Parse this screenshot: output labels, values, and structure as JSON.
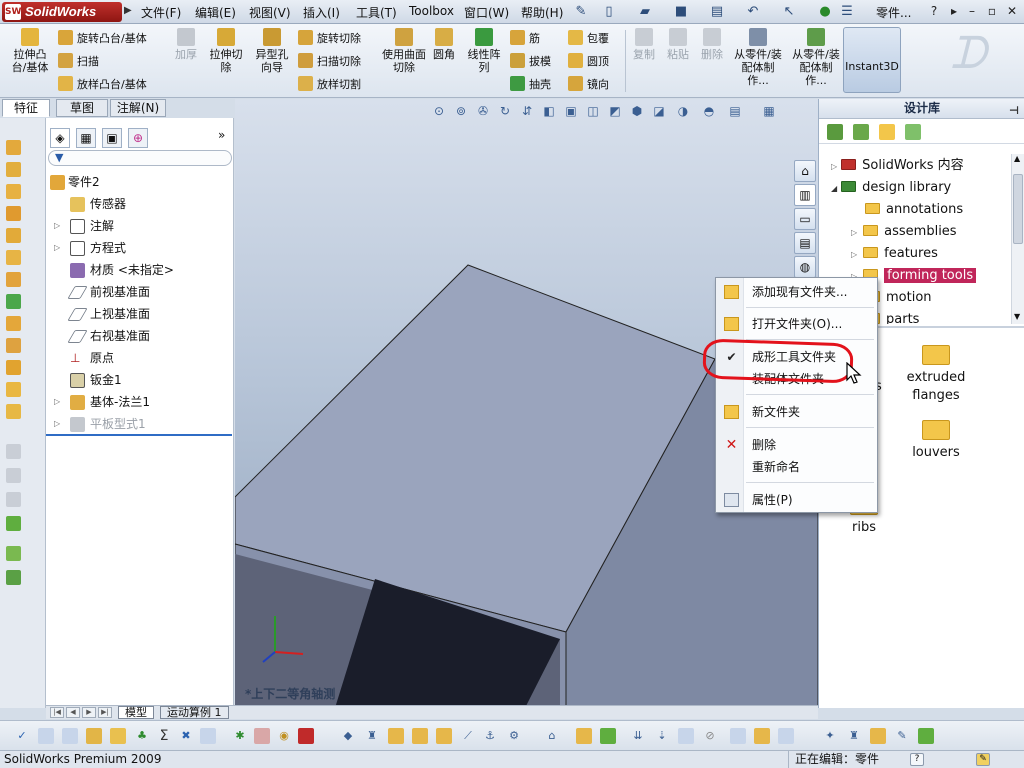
{
  "app": {
    "brand": "SolidWorks",
    "logo_glyph": "SW",
    "document_title": "零件...",
    "menu": [
      "文件(F)",
      "编辑(E)",
      "视图(V)",
      "插入(I)",
      "工具(T)",
      "Toolbox",
      "窗口(W)",
      "帮助(H)"
    ]
  },
  "ribbon": {
    "extrude_boss": "拉伸凸台/基体",
    "revolve_boss": "旋转凸台/基体",
    "sweep": "扫描",
    "loft": "放样凸台/基体",
    "thicken": "加厚",
    "extrude_cut": "拉伸切除",
    "hole_wizard": "异型孔向导",
    "revolve_cut": "旋转切除",
    "sweep_cut": "扫描切除",
    "loft_cut": "放样切割",
    "surface_cut": "使用曲面切除",
    "fillet": "圆角",
    "linear_pattern": "线性阵列",
    "rib": "筋",
    "draft": "拔模",
    "shell": "抽壳",
    "wrap": "包覆",
    "dome": "圆顶",
    "mirror": "镜向",
    "copy": "复制",
    "paste": "粘贴",
    "delete": "删除",
    "from_part_assembly": "从零件/装配体制作...",
    "from_part_assembly2": "从零件/装配体制作...",
    "instant3d": "Instant3D"
  },
  "command_tabs": [
    "特征",
    "草图",
    "注解(N)"
  ],
  "feature_tree": {
    "root": "零件2",
    "items": [
      {
        "label": "传感器",
        "expandable": false
      },
      {
        "label": "注解",
        "expandable": true
      },
      {
        "label": "方程式",
        "expandable": true
      },
      {
        "label": "材质 <未指定>",
        "expandable": false
      },
      {
        "label": "前视基准面",
        "expandable": false
      },
      {
        "label": "上视基准面",
        "expandable": false
      },
      {
        "label": "右视基准面",
        "expandable": false
      },
      {
        "label": "原点",
        "expandable": false
      },
      {
        "label": "钣金1",
        "expandable": false
      },
      {
        "label": "基体-法兰1",
        "expandable": true
      },
      {
        "label": "平板型式1",
        "expandable": true,
        "suppressed": true
      }
    ]
  },
  "graphics": {
    "view_orientation": "*上下二等角轴测"
  },
  "design_library": {
    "title": "设计库",
    "tree": [
      {
        "label": "SolidWorks 内容",
        "level": 0
      },
      {
        "label": "design library",
        "level": 0
      },
      {
        "label": "annotations",
        "level": 1
      },
      {
        "label": "assemblies",
        "level": 1
      },
      {
        "label": "features",
        "level": 1
      },
      {
        "label": "forming tools",
        "level": 1,
        "selected": true
      },
      {
        "label": "motion",
        "level": 1
      },
      {
        "label": "parts",
        "level": 1
      }
    ],
    "tiles": {
      "partial": "es",
      "extruded_flanges": "extruded flanges",
      "louvers": "louvers",
      "ribs": "ribs"
    }
  },
  "context_menu": {
    "items": [
      {
        "label": "添加现有文件夹..."
      },
      {
        "label": "打开文件夹(O)..."
      },
      {
        "label": "成形工具文件夹",
        "checked": true
      },
      {
        "label": "装配体文件夹"
      },
      {
        "label": "新文件夹"
      },
      {
        "label": "删除"
      },
      {
        "label": "重新命名"
      },
      {
        "label": "属性(P)"
      }
    ],
    "check_glyph": "✔"
  },
  "bottom_tabs": [
    "模型",
    "运动算例 1"
  ],
  "statusbar": {
    "product": "SolidWorks Premium 2009",
    "mode": "正在编辑：零件"
  },
  "colors": {
    "context_highlight": "#e3121b",
    "selected_folder": "#c0265a",
    "model_face": "#9aa4bd",
    "background_top": "#d8e0ec"
  }
}
